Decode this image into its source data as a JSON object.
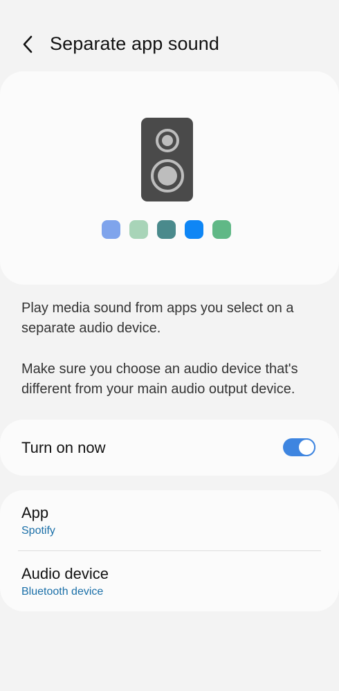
{
  "header": {
    "title": "Separate app sound"
  },
  "hero": {
    "icon": "speaker-icon",
    "app_dot_colors": [
      "#7fa4ec",
      "#a8d4b8",
      "#4a8a8c",
      "#0f86f5",
      "#60b886"
    ]
  },
  "description": {
    "line1": "Play media sound from apps you select on a separate audio device.",
    "line2": "Make sure you choose an audio device that's different from your main audio output device."
  },
  "toggle": {
    "label": "Turn on now",
    "enabled": true,
    "accent_color": "#3e85e0"
  },
  "settings": {
    "app": {
      "title": "App",
      "value": "Spotify"
    },
    "audio_device": {
      "title": "Audio device",
      "value": "Bluetooth device"
    }
  }
}
